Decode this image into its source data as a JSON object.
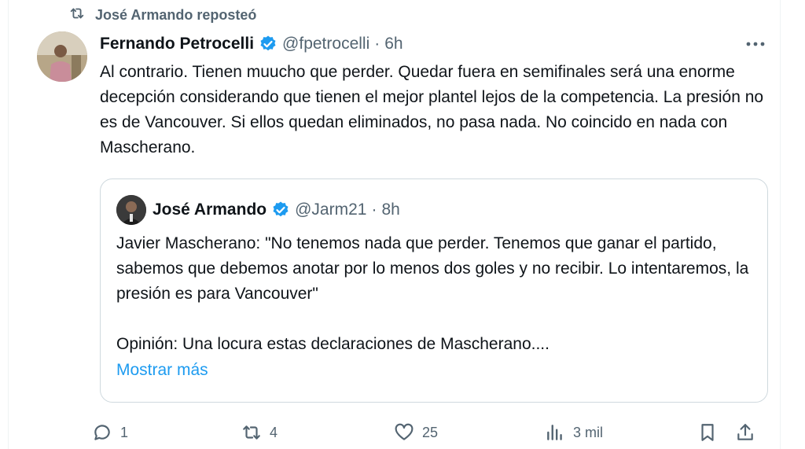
{
  "repost_banner": {
    "text": "José Armando reposteó",
    "icon": "repost-icon"
  },
  "tweet": {
    "author_name": "Fernando Petrocelli",
    "verified": true,
    "handle": "@fpetrocelli",
    "separator": "·",
    "time": "6h",
    "text": "Al contrario. Tienen muucho que perder. Quedar fuera en semifinales será una enorme decepción considerando que tienen el mejor plantel lejos de la competencia. La presión no es de Vancouver. Si ellos quedan eliminados, no pasa nada. No coincido en nada con Mascherano."
  },
  "quote": {
    "author_name": "José Armando",
    "verified": true,
    "handle": "@Jarm21",
    "separator": "·",
    "time": "8h",
    "text_p1": "Javier Mascherano: \"No tenemos nada que perder. Tenemos que ganar el partido, sabemos que debemos anotar por lo menos dos goles y no recibir. Lo intentaremos, la presión es para Vancouver\"",
    "text_p2": "Opinión: Una locura estas declaraciones de Mascherano....",
    "show_more": "Mostrar más"
  },
  "actions": {
    "replies": "1",
    "reposts": "4",
    "likes": "25",
    "views": "3 mil"
  },
  "colors": {
    "accent": "#1d9bf0",
    "secondary_text": "#536471",
    "primary_text": "#0f1419",
    "border": "#cfd9de"
  }
}
